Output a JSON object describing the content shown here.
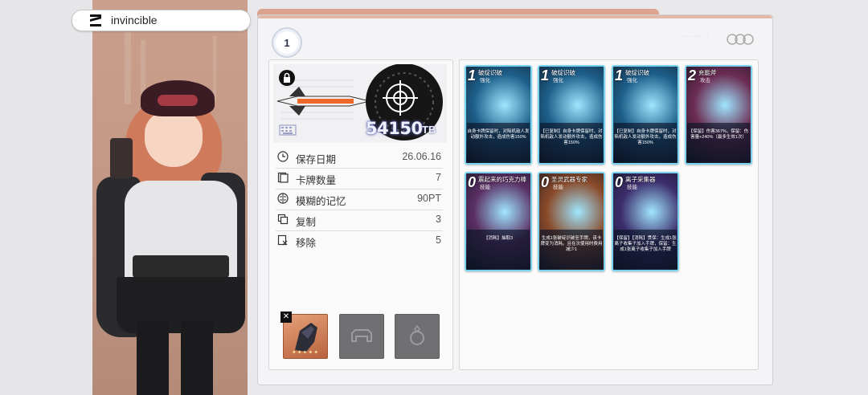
{
  "deck": {
    "name": "invincible",
    "rank": "1"
  },
  "power": {
    "value": "54150",
    "unit": "TB"
  },
  "stats": [
    {
      "label": "保存日期",
      "value": "26.06.16",
      "icon": "clock-icon"
    },
    {
      "label": "卡牌数量",
      "value": "7",
      "icon": "cards-icon"
    },
    {
      "label": "模糊的记忆",
      "value": "90PT",
      "icon": "brain-icon"
    },
    {
      "label": "复制",
      "value": "3",
      "icon": "copy-icon"
    },
    {
      "label": "移除",
      "value": "5",
      "icon": "remove-icon"
    }
  ],
  "equipment": {
    "weapon_stars": "✦✦✦✦✦",
    "weapon_icon": "gauntlet-icon",
    "armor_icon": "armor-icon",
    "accessory_icon": "ring-icon"
  },
  "cards": [
    {
      "cost": "1",
      "title": "破绽识破",
      "type": "强化",
      "desc": "自身卡牌保留时，对陷机敌人发动额外攻击，造成伤害150%",
      "color": "#1d5f8a"
    },
    {
      "cost": "1",
      "title": "破绽识破",
      "type": "强化",
      "desc": "【已复制】自身卡牌保留时，对陷机敌人发动额外攻击，造成伤害150%",
      "color": "#1d5f8a"
    },
    {
      "cost": "1",
      "title": "破绽识破",
      "type": "强化",
      "desc": "【已复制】自身卡牌保留时，对陷机敌人发动额外攻击，造成伤害150%",
      "color": "#1d5f8a"
    },
    {
      "cost": "2",
      "title": "充能斧",
      "type": "攻击",
      "desc": "【保留】伤害367%，保留：伤害量+240%（最多生效1次）",
      "color": "#6b2b52"
    },
    {
      "cost": "0",
      "title": "震起来的巧克力棒",
      "type": "技能",
      "desc": "【消耗】抽取3",
      "color": "#5a2f63"
    },
    {
      "cost": "0",
      "title": "圣灵武器专家",
      "type": "技能",
      "desc": "生成1张破绽识破至手牌，该卡牌变为消耗。且在次使用时费用减少1",
      "color": "#8a4a2a"
    },
    {
      "cost": "0",
      "title": "离子采集器",
      "type": "技能",
      "desc": "【保留】【消耗】贯保：生成1张离子收集子加入手牌，保留：生成1张离子收集子加入手牌",
      "color": "#3c2d6b"
    }
  ]
}
